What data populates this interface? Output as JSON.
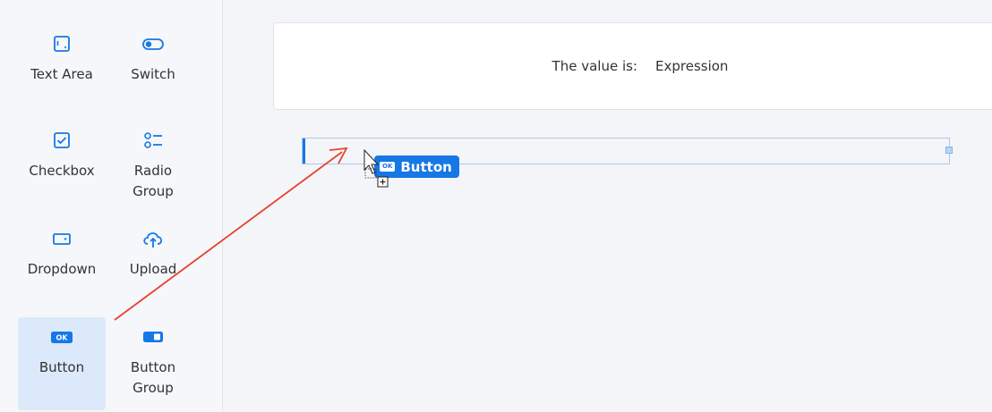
{
  "sidebar": {
    "items": [
      {
        "label": "Text Area",
        "icon": "text-area-icon"
      },
      {
        "label": "Switch",
        "icon": "switch-icon"
      },
      {
        "label": "Checkbox",
        "icon": "checkbox-icon"
      },
      {
        "label": "Radio Group",
        "icon": "radio-group-icon"
      },
      {
        "label": "Dropdown",
        "icon": "dropdown-icon"
      },
      {
        "label": "Upload",
        "icon": "upload-icon"
      },
      {
        "label": "Button",
        "icon": "button-icon",
        "selected": true,
        "icon_text": "OK"
      },
      {
        "label": "Button Group",
        "icon": "button-group-icon"
      }
    ]
  },
  "canvas": {
    "value_label": "The value is:",
    "value_expression": "Expression",
    "drag_chip": {
      "label": "Button",
      "icon_text": "OK"
    }
  },
  "colors": {
    "accent": "#1677e6",
    "arrow": "#e8412f",
    "sidebar_bg": "#f5f7fa",
    "canvas_bg": "#f3f5f8",
    "selected_bg": "#dbe9fa"
  }
}
